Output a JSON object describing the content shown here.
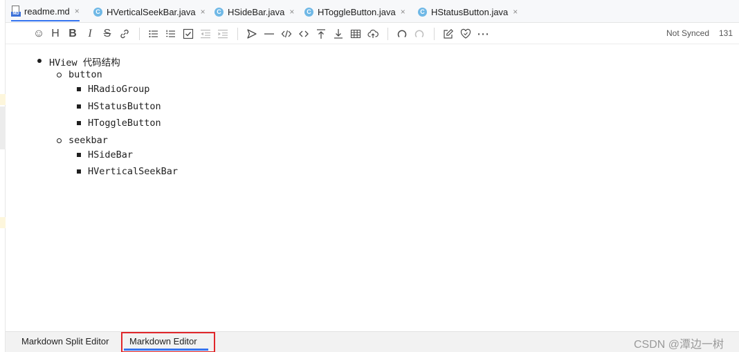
{
  "tabs": [
    {
      "label": "readme.md",
      "icon": "markdown-file-icon",
      "active": true
    },
    {
      "label": "HVerticalSeekBar.java",
      "icon": "java-class-icon",
      "icon_letter": "C"
    },
    {
      "label": "HSideBar.java",
      "icon": "java-class-icon",
      "icon_letter": "C"
    },
    {
      "label": "HToggleButton.java",
      "icon": "java-class-icon",
      "icon_letter": "C"
    },
    {
      "label": "HStatusButton.java",
      "icon": "java-class-icon",
      "icon_letter": "C"
    }
  ],
  "tab_close_glyph": "×",
  "md_icon_text": "MD",
  "toolbar": {
    "icons": [
      {
        "name": "emoji-icon",
        "glyph": "☺"
      },
      {
        "name": "heading-icon",
        "glyph": "H"
      },
      {
        "name": "bold-icon",
        "glyph": "B"
      },
      {
        "name": "italic-icon",
        "glyph": "I"
      },
      {
        "name": "strikethrough-icon",
        "glyph": "S"
      },
      {
        "name": "link-icon",
        "glyph": "🔗"
      },
      {
        "name": "bullet-list-icon",
        "glyph": "☰"
      },
      {
        "name": "ordered-list-icon",
        "glyph": "☰"
      },
      {
        "name": "checklist-icon",
        "glyph": "☑"
      },
      {
        "name": "outdent-icon",
        "glyph": "⇤"
      },
      {
        "name": "indent-icon",
        "glyph": "⇥"
      },
      {
        "name": "quote-icon",
        "glyph": "➤"
      },
      {
        "name": "horizontal-rule-icon",
        "glyph": "—"
      },
      {
        "name": "code-icon",
        "glyph": "</>"
      },
      {
        "name": "inline-code-icon",
        "glyph": "<>"
      },
      {
        "name": "insert-before-icon",
        "glyph": "⤒"
      },
      {
        "name": "insert-after-icon",
        "glyph": "⤓"
      },
      {
        "name": "table-icon",
        "glyph": "▦"
      },
      {
        "name": "upload-icon",
        "glyph": "☁"
      },
      {
        "name": "undo-icon",
        "glyph": "↶"
      },
      {
        "name": "redo-icon",
        "glyph": "↷"
      },
      {
        "name": "edit-icon",
        "glyph": "✎"
      },
      {
        "name": "heart-icon",
        "glyph": "♡"
      },
      {
        "name": "more-icon",
        "glyph": "⋯"
      }
    ],
    "sync_status": "Not Synced",
    "count": "131"
  },
  "content": {
    "root": "HView 代码结构",
    "groups": [
      {
        "label": "button",
        "children": [
          "HRadioGroup",
          "HStatusButton",
          "HToggleButton"
        ]
      },
      {
        "label": "seekbar",
        "children": [
          "HSideBar",
          "HVerticalSeekBar"
        ]
      }
    ]
  },
  "bottom_tabs": {
    "split_editor": "Markdown Split Editor",
    "editor": "Markdown Editor"
  },
  "watermark": "CSDN @潭边一树",
  "colors": {
    "accent": "#3574f0",
    "highlight": "#e0262a",
    "java_icon": "#6fb8e6"
  }
}
